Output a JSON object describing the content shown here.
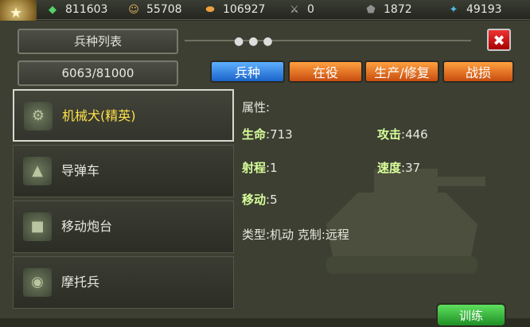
{
  "resources": [
    {
      "icon": "gem-icon",
      "value": "811603",
      "color": "#55d36b"
    },
    {
      "icon": "soldier-icon",
      "value": "55708",
      "color": "#e0b060"
    },
    {
      "icon": "bread-icon",
      "value": "106927",
      "color": "#f0a040"
    },
    {
      "icon": "bullet-icon",
      "value": "0",
      "color": "#c0c0c0"
    },
    {
      "icon": "ore-icon",
      "value": "1872",
      "color": "#909090"
    },
    {
      "icon": "crystal-icon",
      "value": "49193",
      "color": "#4fb9e8"
    }
  ],
  "panel": {
    "title": "兵种列表",
    "capacity": "6063/81000",
    "close_symbol": "✖"
  },
  "tabs": [
    {
      "label": "兵种",
      "color": "#1a63c9",
      "active": true
    },
    {
      "label": "在役",
      "color": "#c84d10",
      "active": false
    },
    {
      "label": "生产/修复",
      "color": "#c84d10",
      "active": false
    },
    {
      "label": "战损",
      "color": "#c84d10",
      "active": false
    }
  ],
  "units": [
    {
      "name": "机械犬(精英)",
      "selected": true
    },
    {
      "name": "导弹车",
      "selected": false
    },
    {
      "name": "移动炮台",
      "selected": false
    },
    {
      "name": "摩托兵",
      "selected": false
    }
  ],
  "detail": {
    "attributes_label": "属性:",
    "hp_label": "生命",
    "hp_value": ":713",
    "attack_label": "攻击",
    "attack_value": ":446",
    "range_label": "射程",
    "range_value": ":1",
    "speed_label": "速度",
    "speed_value": ":37",
    "move_label": "移动",
    "move_value": ":5",
    "type_text": "类型:机动  克制:远程"
  },
  "train_button": "训练"
}
